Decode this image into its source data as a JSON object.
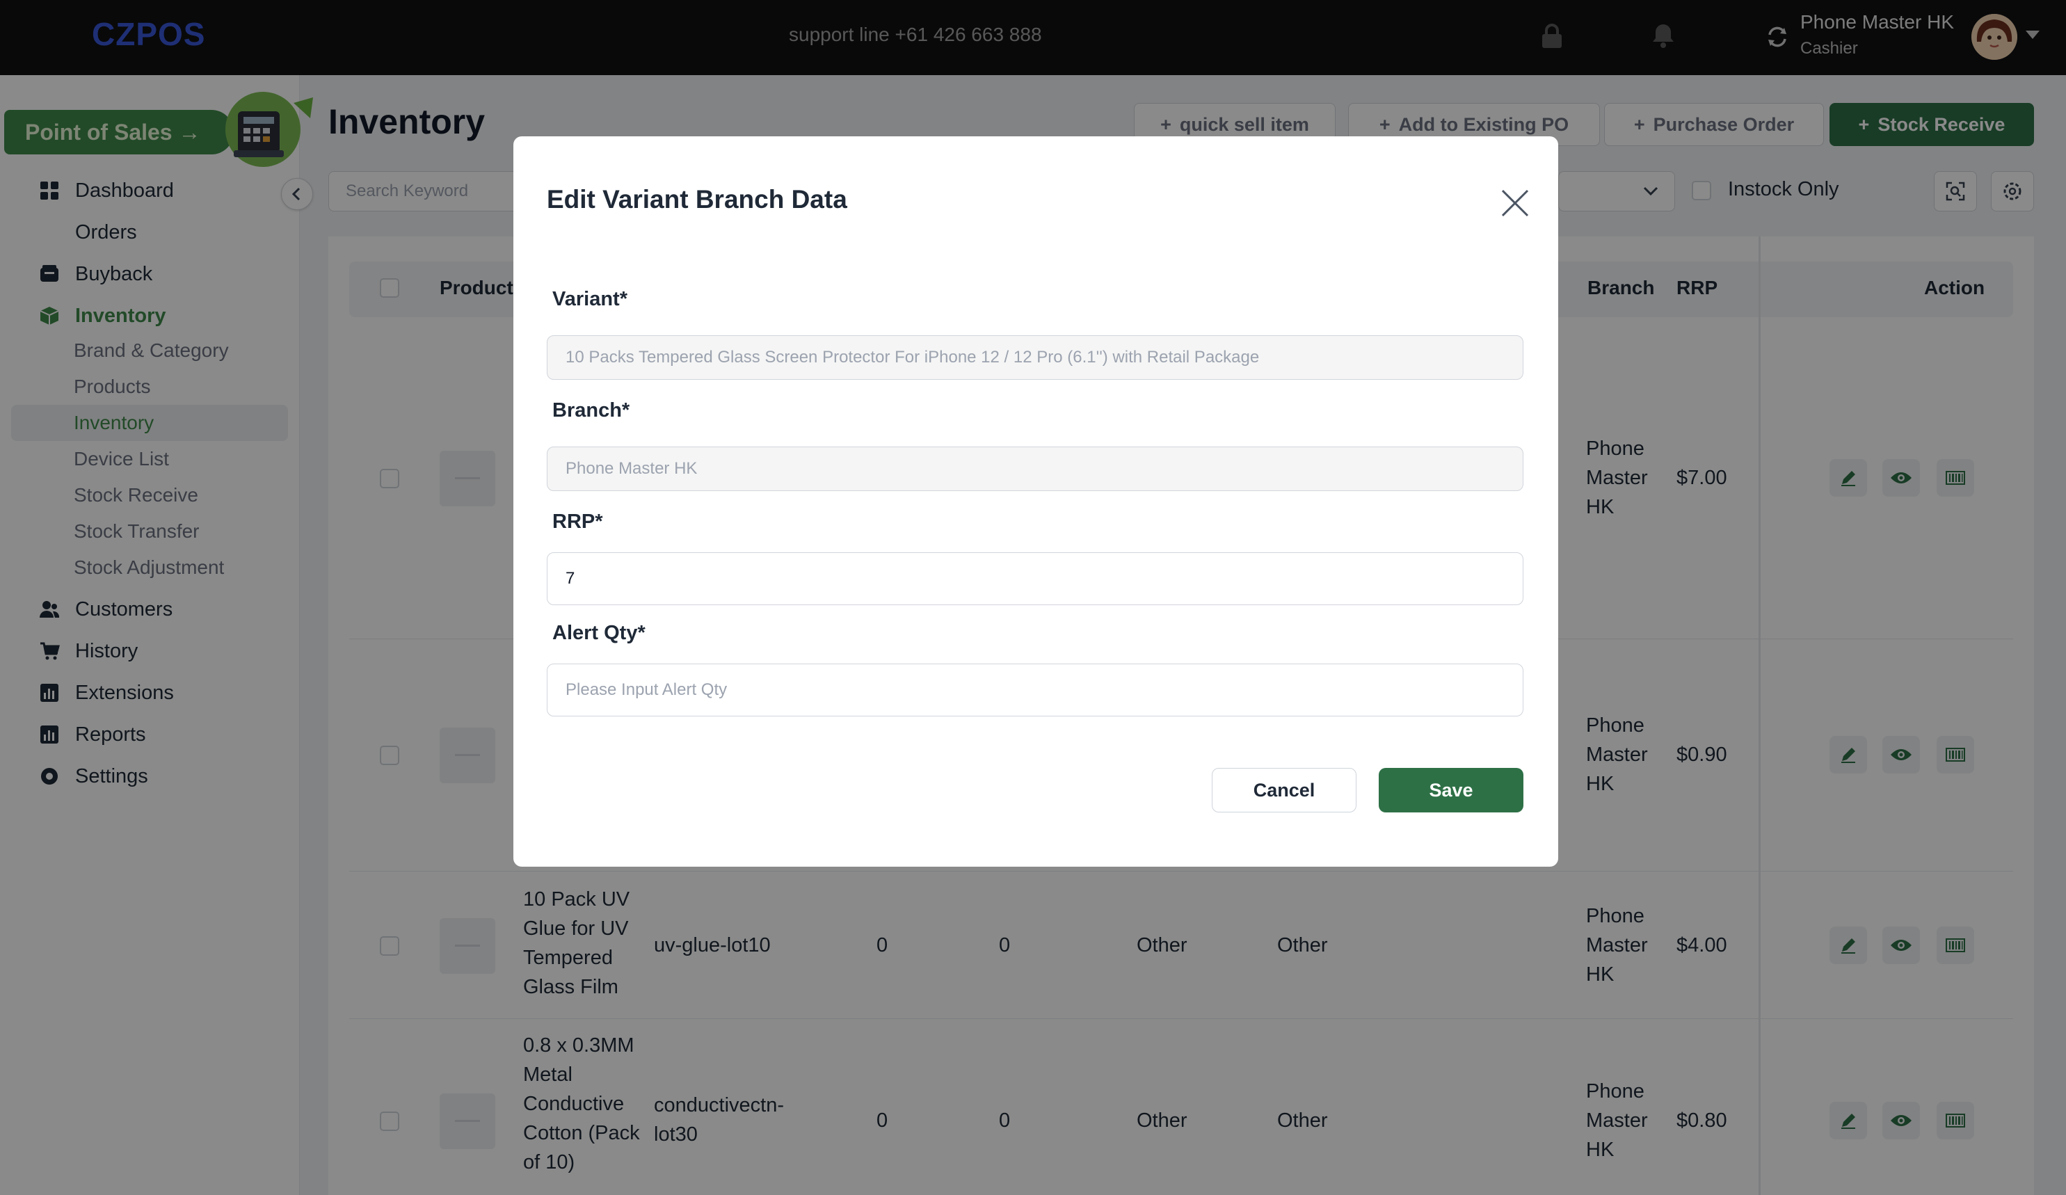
{
  "topbar": {
    "logo": "CZPOS",
    "support": "support line +61 426 663 888",
    "user_name": "Phone Master HK",
    "user_role": "Cashier"
  },
  "sidebar": {
    "pos_button": "Point of Sales →",
    "items": [
      {
        "label": "Dashboard",
        "icon": "dashboard-icon"
      },
      {
        "label": "Orders"
      },
      {
        "label": "Buyback",
        "icon": "wallet-icon"
      },
      {
        "label": "Inventory",
        "icon": "box-icon",
        "active": true
      },
      {
        "label": "Customers",
        "icon": "customers-icon"
      },
      {
        "label": "History",
        "icon": "cart-icon"
      },
      {
        "label": "Extensions",
        "icon": "chart-icon"
      },
      {
        "label": "Reports",
        "icon": "chart-icon"
      },
      {
        "label": "Settings",
        "icon": "gear-icon"
      }
    ],
    "inventory_sub": [
      "Brand & Category",
      "Products",
      "Inventory",
      "Device List",
      "Stock Receive",
      "Stock Transfer",
      "Stock Adjustment"
    ]
  },
  "page": {
    "title": "Inventory",
    "buttons": [
      "quick sell item",
      "Add to Existing PO",
      "Purchase Order",
      "Stock Receive"
    ],
    "search_placeholder": "Search Keyword",
    "instock_label": "Instock Only"
  },
  "table": {
    "headers": {
      "product": "Product",
      "branch": "Branch",
      "rrp": "RRP",
      "action": "Action"
    },
    "rows": [
      {
        "name": "",
        "sku": "",
        "q1": "",
        "q2": "",
        "c1": "",
        "c2": "",
        "branch": "Phone Master HK",
        "rrp": "$7.00"
      },
      {
        "name": "",
        "sku": "",
        "q1": "",
        "q2": "",
        "c1": "",
        "c2": "",
        "branch": "Phone Master HK",
        "rrp": "$0.90"
      },
      {
        "name": "10 Pack UV Glue for UV Tempered Glass Film",
        "sku": "uv-glue-lot10",
        "q1": "0",
        "q2": "0",
        "c1": "Other",
        "c2": "Other",
        "branch": "Phone Master HK",
        "rrp": "$4.00"
      },
      {
        "name": "0.8 x 0.3MM Metal Conductive Cotton (Pack of 10)",
        "sku": "conductivectn-lot30",
        "q1": "0",
        "q2": "0",
        "c1": "Other",
        "c2": "Other",
        "branch": "Phone Master HK",
        "rrp": "$0.80"
      }
    ]
  },
  "modal": {
    "title": "Edit Variant Branch Data",
    "variant_label": "Variant",
    "variant_value": "10 Packs Tempered Glass Screen Protector For iPhone 12 / 12 Pro (6.1'') with Retail Package",
    "branch_label": "Branch",
    "branch_value": "Phone Master HK",
    "rrp_label": "RRP",
    "rrp_value": "7",
    "alert_label": "Alert Qty",
    "alert_placeholder": "Please Input Alert Qty",
    "required_mark": "*",
    "cancel": "Cancel",
    "save": "Save"
  },
  "colors": {
    "accent": "#2e7046",
    "logo": "#3a57d8",
    "topbar": "#111214"
  }
}
